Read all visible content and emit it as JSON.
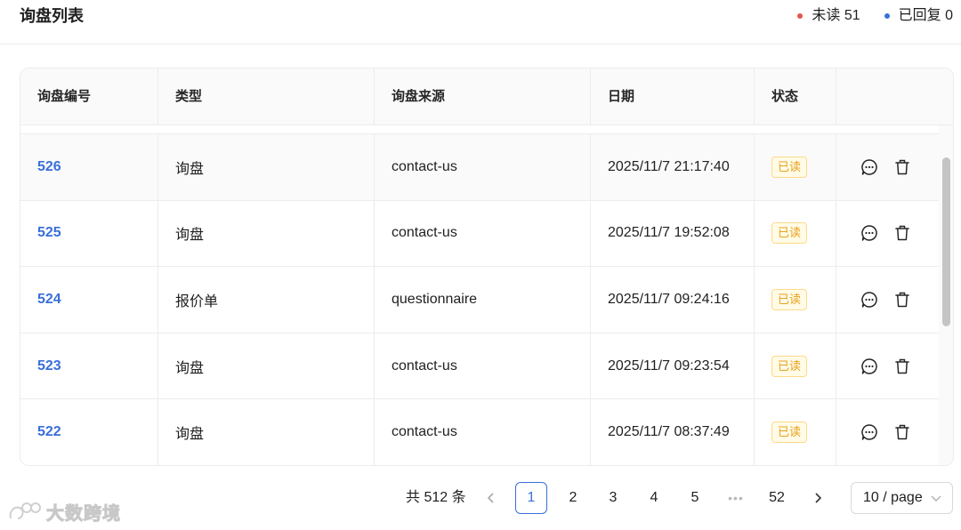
{
  "header": {
    "title": "询盘列表",
    "unread_label": "未读 51",
    "replied_label": "已回复 0",
    "unread_dot_color": "#e5544b",
    "replied_dot_color": "#3a6fd8"
  },
  "table": {
    "columns": [
      "询盘编号",
      "类型",
      "询盘来源",
      "日期",
      "状态",
      ""
    ],
    "rows": [
      {
        "id": "526",
        "type": "询盘",
        "source": "contact-us",
        "date": "2025/11/7 21:17:40",
        "status": "已读"
      },
      {
        "id": "525",
        "type": "询盘",
        "source": "contact-us",
        "date": "2025/11/7 19:52:08",
        "status": "已读"
      },
      {
        "id": "524",
        "type": "报价单",
        "source": "questionnaire",
        "date": "2025/11/7 09:24:16",
        "status": "已读"
      },
      {
        "id": "523",
        "type": "询盘",
        "source": "contact-us",
        "date": "2025/11/7 09:23:54",
        "status": "已读"
      },
      {
        "id": "522",
        "type": "询盘",
        "source": "contact-us",
        "date": "2025/11/7 08:37:49",
        "status": "已读"
      }
    ],
    "row_actions": [
      "message-icon",
      "trash-icon"
    ]
  },
  "pagination": {
    "total_label": "共 512 条",
    "pages": [
      "1",
      "2",
      "3",
      "4",
      "5",
      "•••",
      "52"
    ],
    "current_page": "1",
    "page_size_label": "10 / page"
  },
  "watermark": {
    "text": "大数跨境"
  },
  "colors": {
    "accent": "#3a6fd8",
    "badge_text": "#e8a21d",
    "badge_bg": "#fffbe6"
  }
}
